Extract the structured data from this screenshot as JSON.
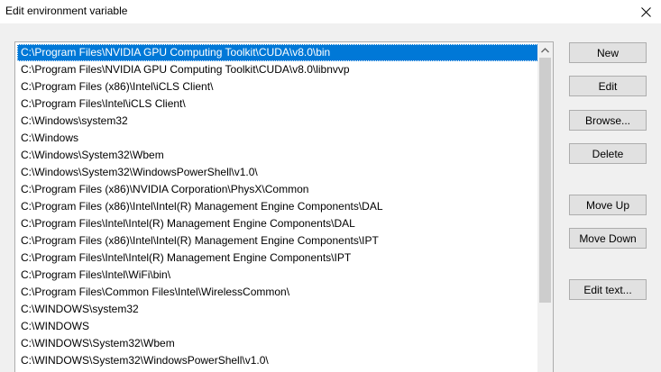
{
  "window": {
    "title": "Edit environment variable",
    "close_icon": "close-icon"
  },
  "list": {
    "selected_index": 0,
    "items": [
      "C:\\Program Files\\NVIDIA GPU Computing Toolkit\\CUDA\\v8.0\\bin",
      "C:\\Program Files\\NVIDIA GPU Computing Toolkit\\CUDA\\v8.0\\libnvvp",
      "C:\\Program Files (x86)\\Intel\\iCLS Client\\",
      "C:\\Program Files\\Intel\\iCLS Client\\",
      "C:\\Windows\\system32",
      "C:\\Windows",
      "C:\\Windows\\System32\\Wbem",
      "C:\\Windows\\System32\\WindowsPowerShell\\v1.0\\",
      "C:\\Program Files (x86)\\NVIDIA Corporation\\PhysX\\Common",
      "C:\\Program Files (x86)\\Intel\\Intel(R) Management Engine Components\\DAL",
      "C:\\Program Files\\Intel\\Intel(R) Management Engine Components\\DAL",
      "C:\\Program Files (x86)\\Intel\\Intel(R) Management Engine Components\\IPT",
      "C:\\Program Files\\Intel\\Intel(R) Management Engine Components\\IPT",
      "C:\\Program Files\\Intel\\WiFi\\bin\\",
      "C:\\Program Files\\Common Files\\Intel\\WirelessCommon\\",
      "C:\\WINDOWS\\system32",
      "C:\\WINDOWS",
      "C:\\WINDOWS\\System32\\Wbem",
      "C:\\WINDOWS\\System32\\WindowsPowerShell\\v1.0\\"
    ]
  },
  "buttons": {
    "new_label": "New",
    "edit_label": "Edit",
    "browse_label": "Browse...",
    "delete_label": "Delete",
    "move_up_label": "Move Up",
    "move_down_label": "Move Down",
    "edit_text_label": "Edit text..."
  },
  "colors": {
    "selection": "#0078d7",
    "button_face": "#e1e1e1",
    "button_border": "#adadad"
  }
}
